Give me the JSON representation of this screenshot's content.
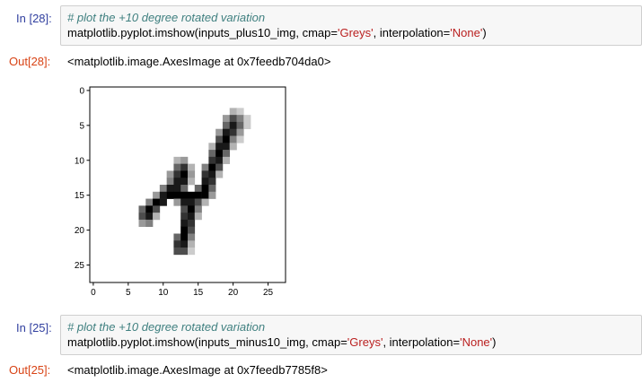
{
  "cells": [
    {
      "in_prompt": "In [28]:",
      "comment": "# plot the +10 degree rotated variation",
      "code_pre": "matplotlib.pyplot.imshow(inputs_plus10_img, cmap=",
      "code_str1": "'Greys'",
      "code_mid": ", interpolation=",
      "code_str2": "'None'",
      "code_post": ")",
      "out_prompt": "Out[28]:",
      "output": "<matplotlib.image.AxesImage at 0x7feedb704da0>"
    },
    {
      "in_prompt": "In [25]:",
      "comment": "# plot the +10 degree rotated variation",
      "code_pre": "matplotlib.pyplot.imshow(inputs_minus10_img, cmap=",
      "code_str1": "'Greys'",
      "code_mid": ", interpolation=",
      "code_str2": "'None'",
      "code_post": ")",
      "out_prompt": "Out[25]:",
      "output": "<matplotlib.image.AxesImage at 0x7feedb7785f8>"
    }
  ],
  "chart_data": {
    "type": "heatmap",
    "cmap": "Greys",
    "xlim": [
      -0.5,
      27.5
    ],
    "ylim": [
      27.5,
      -0.5
    ],
    "x_ticks": [
      0,
      5,
      10,
      15,
      20,
      25
    ],
    "y_ticks": [
      0,
      5,
      10,
      15,
      20,
      25
    ],
    "grid": false,
    "pixels": [
      [
        3,
        20,
        0.3
      ],
      [
        3,
        21,
        0.2
      ],
      [
        4,
        19,
        0.4
      ],
      [
        4,
        20,
        0.7
      ],
      [
        4,
        21,
        0.5
      ],
      [
        4,
        22,
        0.2
      ],
      [
        5,
        19,
        0.6
      ],
      [
        5,
        20,
        0.9
      ],
      [
        5,
        21,
        0.6
      ],
      [
        5,
        22,
        0.2
      ],
      [
        6,
        18,
        0.4
      ],
      [
        6,
        19,
        0.9
      ],
      [
        6,
        20,
        0.8
      ],
      [
        6,
        21,
        0.4
      ],
      [
        7,
        18,
        0.7
      ],
      [
        7,
        19,
        1.0
      ],
      [
        7,
        20,
        0.5
      ],
      [
        7,
        21,
        0.2
      ],
      [
        8,
        17,
        0.3
      ],
      [
        8,
        18,
        0.9
      ],
      [
        8,
        19,
        0.9
      ],
      [
        8,
        20,
        0.3
      ],
      [
        9,
        17,
        0.6
      ],
      [
        9,
        18,
        1.0
      ],
      [
        9,
        19,
        0.6
      ],
      [
        10,
        12,
        0.3
      ],
      [
        10,
        13,
        0.4
      ],
      [
        10,
        17,
        0.8
      ],
      [
        10,
        18,
        0.9
      ],
      [
        10,
        19,
        0.3
      ],
      [
        11,
        12,
        0.6
      ],
      [
        11,
        13,
        0.8
      ],
      [
        11,
        14,
        0.3
      ],
      [
        11,
        16,
        0.5
      ],
      [
        11,
        17,
        1.0
      ],
      [
        11,
        18,
        0.7
      ],
      [
        12,
        11,
        0.4
      ],
      [
        12,
        12,
        0.8
      ],
      [
        12,
        13,
        1.0
      ],
      [
        12,
        14,
        0.4
      ],
      [
        12,
        16,
        0.8
      ],
      [
        12,
        17,
        0.9
      ],
      [
        12,
        18,
        0.3
      ],
      [
        13,
        11,
        0.5
      ],
      [
        13,
        12,
        0.9
      ],
      [
        13,
        13,
        0.9
      ],
      [
        13,
        14,
        0.3
      ],
      [
        13,
        16,
        0.9
      ],
      [
        13,
        17,
        0.8
      ],
      [
        14,
        10,
        0.5
      ],
      [
        14,
        11,
        0.9
      ],
      [
        14,
        12,
        0.9
      ],
      [
        14,
        13,
        0.6
      ],
      [
        14,
        15,
        0.6
      ],
      [
        14,
        16,
        1.0
      ],
      [
        14,
        17,
        0.6
      ],
      [
        15,
        9,
        0.4
      ],
      [
        15,
        10,
        0.9
      ],
      [
        15,
        11,
        1.0
      ],
      [
        15,
        12,
        1.0
      ],
      [
        15,
        13,
        1.0
      ],
      [
        15,
        14,
        1.0
      ],
      [
        15,
        15,
        1.0
      ],
      [
        15,
        16,
        1.0
      ],
      [
        15,
        17,
        0.4
      ],
      [
        16,
        8,
        0.5
      ],
      [
        16,
        9,
        1.0
      ],
      [
        16,
        10,
        0.9
      ],
      [
        16,
        12,
        0.4
      ],
      [
        16,
        13,
        0.9
      ],
      [
        16,
        14,
        0.9
      ],
      [
        16,
        15,
        0.7
      ],
      [
        16,
        16,
        0.3
      ],
      [
        17,
        7,
        0.6
      ],
      [
        17,
        8,
        1.0
      ],
      [
        17,
        9,
        0.7
      ],
      [
        17,
        13,
        0.7
      ],
      [
        17,
        14,
        1.0
      ],
      [
        17,
        15,
        0.5
      ],
      [
        18,
        7,
        0.7
      ],
      [
        18,
        8,
        0.9
      ],
      [
        18,
        9,
        0.3
      ],
      [
        18,
        13,
        0.8
      ],
      [
        18,
        14,
        0.9
      ],
      [
        18,
        15,
        0.3
      ],
      [
        19,
        7,
        0.4
      ],
      [
        19,
        8,
        0.5
      ],
      [
        19,
        13,
        0.9
      ],
      [
        19,
        14,
        0.8
      ],
      [
        20,
        13,
        1.0
      ],
      [
        20,
        14,
        0.7
      ],
      [
        21,
        12,
        0.6
      ],
      [
        21,
        13,
        1.0
      ],
      [
        21,
        14,
        0.5
      ],
      [
        22,
        12,
        0.8
      ],
      [
        22,
        13,
        0.9
      ],
      [
        22,
        14,
        0.3
      ],
      [
        23,
        12,
        0.7
      ],
      [
        23,
        13,
        0.7
      ],
      [
        23,
        14,
        0.2
      ]
    ]
  }
}
